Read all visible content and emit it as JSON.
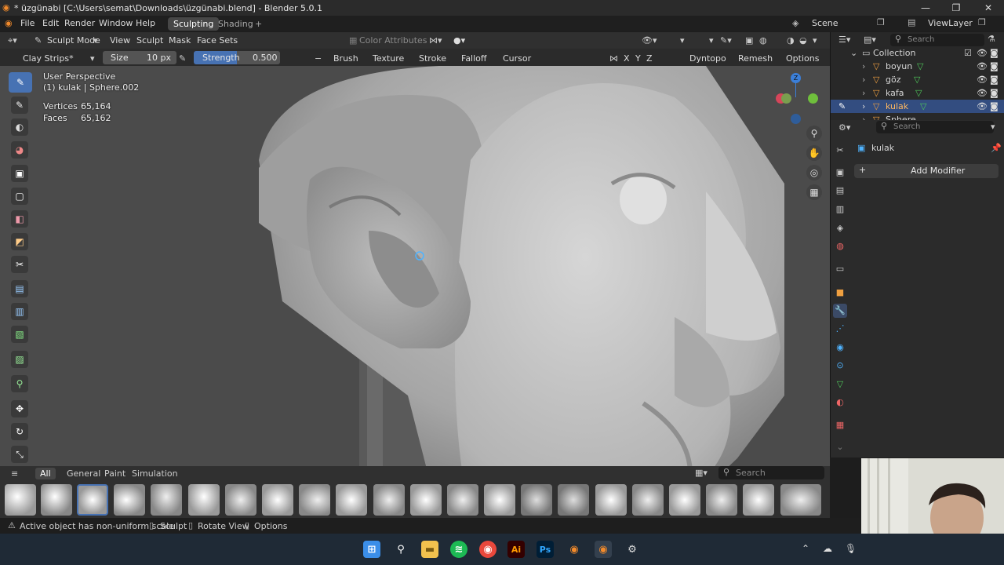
{
  "window": {
    "title": "* üzgünabi [C:\\Users\\semat\\Downloads\\üzgünabi.blend] - Blender 5.0.1",
    "minimize": "—",
    "maximize": "❐",
    "close": "✕"
  },
  "menubar": {
    "items": [
      "File",
      "Edit",
      "Render",
      "Window",
      "Help"
    ],
    "workspaces": [
      "Sculpting",
      "Shading"
    ],
    "add_tab": "+",
    "scene": "Scene",
    "view_layer": "ViewLayer"
  },
  "viewport_header": {
    "mode": "Sculpt Mode",
    "menus": [
      "View",
      "Sculpt",
      "Mask",
      "Face Sets"
    ],
    "color_attributes": "Color Attributes"
  },
  "tool_header": {
    "brush_name": "Clay Strips*",
    "size_label": "Size",
    "size_value": "10 px",
    "strength_label": "Strength",
    "strength_value": "0.500",
    "plus": "+",
    "minus": "−",
    "menus": [
      "Brush",
      "Texture",
      "Stroke",
      "Falloff",
      "Cursor"
    ],
    "axes": [
      "X",
      "Y",
      "Z"
    ],
    "dyntopo": "Dyntopo",
    "remesh": "Remesh",
    "options": "Options"
  },
  "viewport": {
    "perspective": "User Perspective",
    "object_info": "(1) kulak | Sphere.002",
    "vertices_label": "Vertices",
    "vertices_value": "65,164",
    "faces_label": "Faces",
    "faces_value": "65,162",
    "gizmo_z": "Z"
  },
  "asset_shelf": {
    "tabs": [
      "All",
      "General",
      "Paint",
      "Simulation"
    ],
    "search_placeholder": "Search"
  },
  "statusbar": {
    "warning": "Active object has non-uniform scale",
    "hint1": "Sculpt",
    "hint2": "Rotate View",
    "hint3": "Options"
  },
  "outliner": {
    "search_placeholder": "Search",
    "collection": "Collection",
    "items": [
      "boyun",
      "göz",
      "kafa",
      "kulak",
      "Sphere"
    ]
  },
  "properties": {
    "search_placeholder": "Search",
    "object_name": "kulak",
    "add_modifier": "Add Modifier",
    "add_modifier_plus": "+"
  },
  "taskbar": {
    "adobe_illustrator": "Ai",
    "photoshop": "Ps"
  },
  "colors": {
    "accent_blue": "#4772b3",
    "selected_row": "#334d80",
    "mesh_icon_green": "#4fc95b",
    "panel_bg": "#2b2b2b"
  }
}
